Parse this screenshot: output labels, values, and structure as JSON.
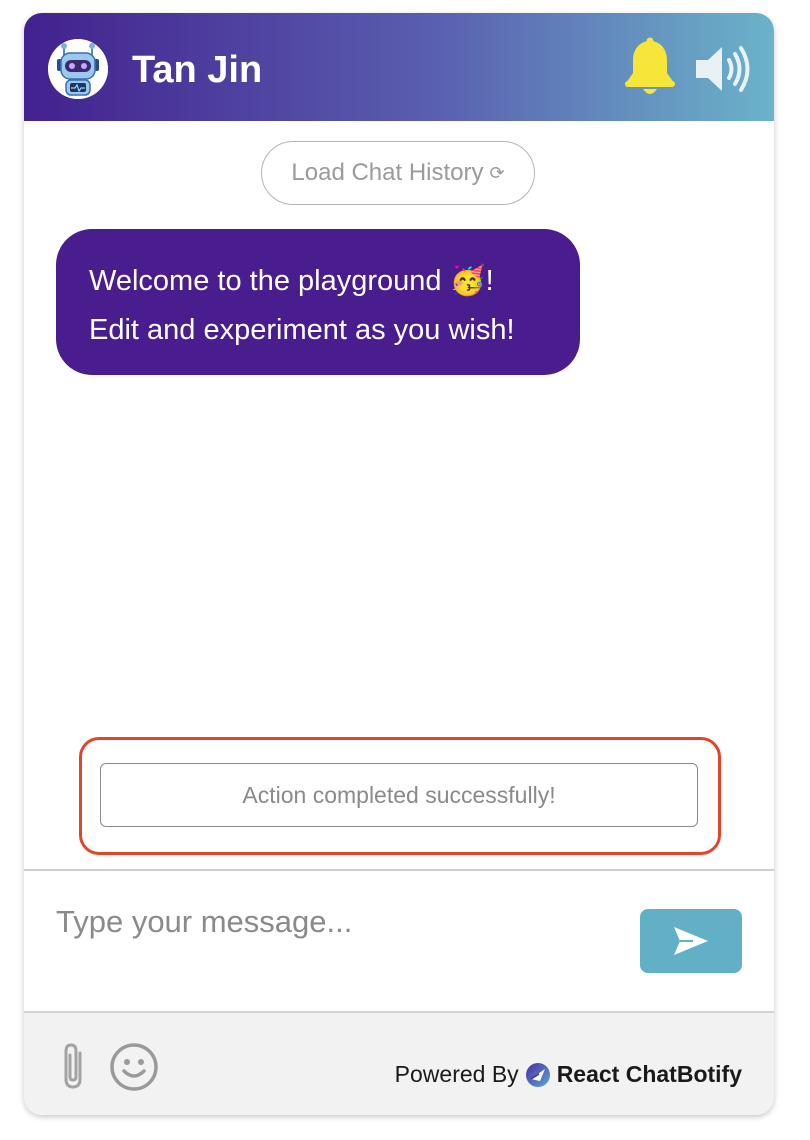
{
  "header": {
    "title": "Tan Jin",
    "avatar_icon": "robot-avatar-icon",
    "notification_icon": "bell-icon",
    "audio_icon": "speaker-icon",
    "colors": {
      "gradient_start": "#42218e",
      "gradient_end": "#6bb3c9",
      "bell": "#f7e63a"
    }
  },
  "chat": {
    "load_history_label": "Load Chat History",
    "load_history_icon": "⟳",
    "messages": [
      {
        "sender": "bot",
        "lines": [
          "Welcome to the playground 🥳!",
          "Edit and experiment as you wish!"
        ]
      }
    ],
    "toast": "Action completed successfully!",
    "colors": {
      "bot_bubble": "#491d8d",
      "toast_highlight": "#e2452a"
    }
  },
  "input": {
    "placeholder": "Type your message...",
    "send_icon": "send-icon",
    "colors": {
      "send_button": "#62b0c6"
    }
  },
  "footer": {
    "attach_icon": "paperclip-icon",
    "emoji_icon": "smiley-icon",
    "powered_by_label": "Powered By",
    "brand_name": "React ChatBotify"
  }
}
